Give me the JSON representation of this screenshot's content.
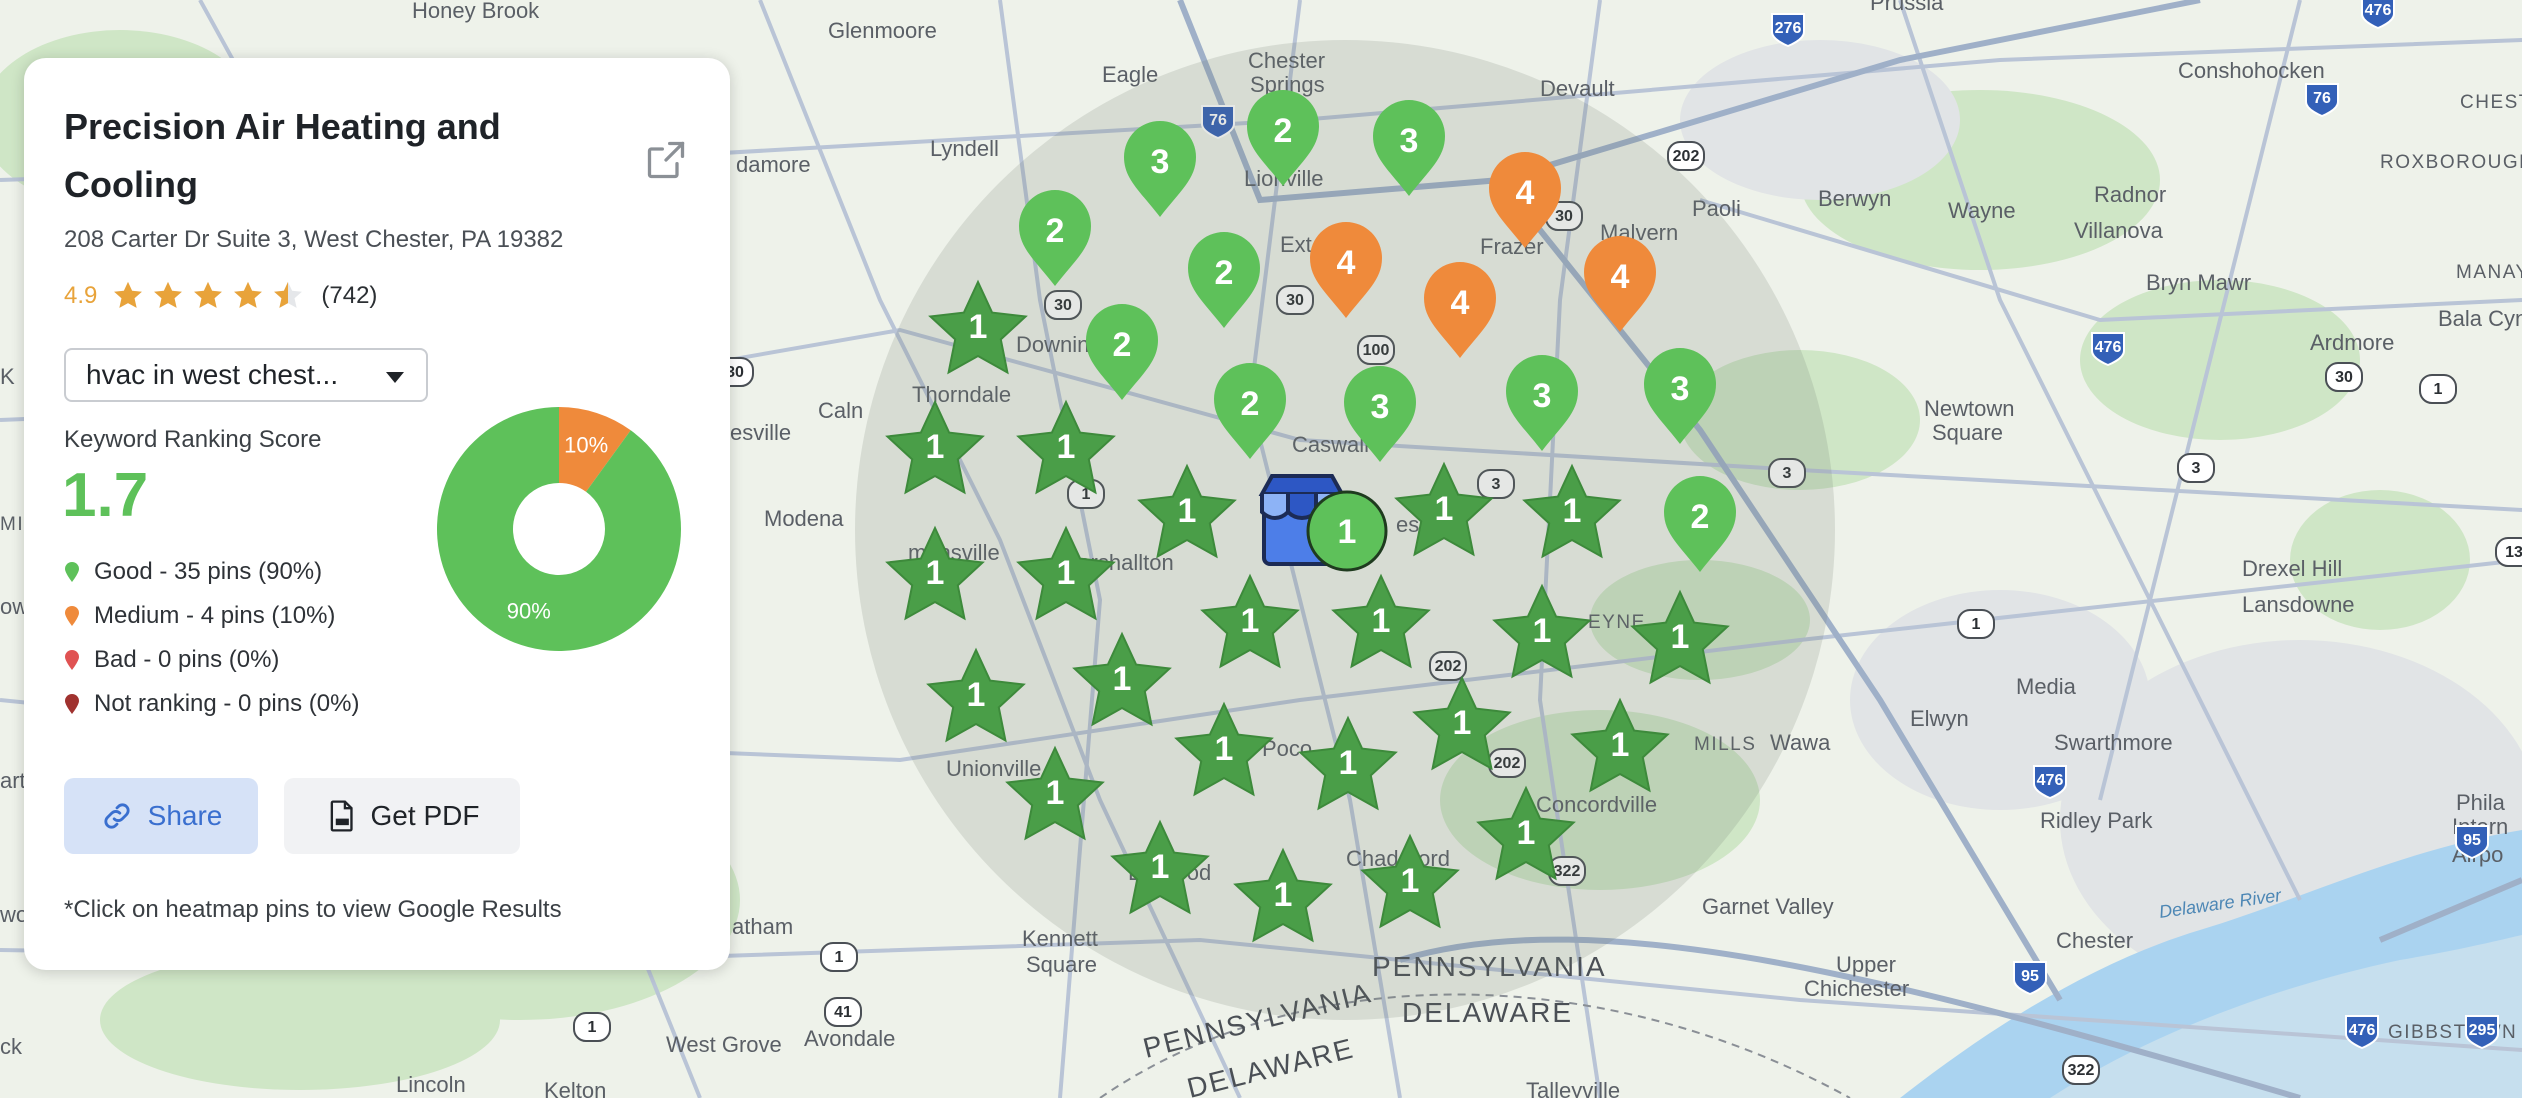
{
  "business": {
    "name": "Precision Air Heating and Cooling",
    "address": "208 Carter Dr Suite 3, West Chester, PA 19382",
    "rating": "4.9",
    "review_count": "(742)",
    "stars_filled": 4.5
  },
  "keyword": {
    "selected": "hvac in west chest..."
  },
  "score": {
    "label": "Keyword Ranking Score",
    "value": "1.7"
  },
  "legend": [
    {
      "label": "Good - 35 pins (90%)",
      "color": "#5ec15a"
    },
    {
      "label": "Medium - 4 pins (10%)",
      "color": "#ef8a3b"
    },
    {
      "label": "Bad - 0 pins (0%)",
      "color": "#e05252"
    },
    {
      "label": "Not ranking - 0 pins (0%)",
      "color": "#a0322f"
    }
  ],
  "donut": {
    "good_pct": 90,
    "medium_pct": 10,
    "good_label": "90%",
    "medium_label": "10%",
    "good_color": "#5ec15a",
    "medium_color": "#ef8a3b"
  },
  "actions": {
    "share": "Share",
    "pdf": "Get PDF"
  },
  "footnote": "*Click on heatmap pins to view Google Results",
  "center_pin": {
    "rank": "1"
  },
  "map_labels": {
    "honey_brook": "Honey Brook",
    "glenmoore": "Glenmoore",
    "chester_springs_1": "Chester",
    "chester_springs_2": "Springs",
    "eagle": "Eagle",
    "devault": "Devault",
    "prussia": "Prussia",
    "conshohocken": "Conshohocken",
    "chest": "CHEST",
    "roxborough": "ROXBOROUGH",
    "manayunk": "MANAYUN",
    "lyndell": "Lyndell",
    "lionville": "Lionville",
    "damore": "damore",
    "malvern": "Malvern",
    "frazer": "Frazer",
    "paoli": "Paoli",
    "berwyn": "Berwyn",
    "wayne": "Wayne",
    "radnor": "Radnor",
    "villanova": "Villanova",
    "bryn_mawr": "Bryn Mawr",
    "bala_cynwyd": "Bala Cynwy",
    "ardmore": "Ardmore",
    "exton": "Ext",
    "downingtown": "Downin",
    "thorndale": "Thorndale",
    "calm": "Caln",
    "coatesville": "esville",
    "caswallen": "Caswall",
    "newtown_square_1": "Newtown",
    "newtown_square_2": "Square",
    "modena": "Modena",
    "embreeville": "mansville",
    "marshallton": "Marshallton",
    "westchester": "es",
    "drexel_hill": "Drexel Hill",
    "lansdowne": "Lansdowne",
    "media": "Media",
    "elwyn": "Elwyn",
    "wawa": "Wawa",
    "swarthmore": "Swarthmore",
    "unionville": "Unionville",
    "pocopson": "Poco",
    "concordville": "Concordville",
    "ridley_park": "Ridley Park",
    "philadelphia_1": "Phila",
    "philadelphia_2": "Intern",
    "philadelphia_3": "Airpo",
    "chadds_ford": "Chad   Ford",
    "cheyney": "EYNE",
    "hills": "MILLS",
    "garnet_valley": "Garnet Valley",
    "kennett_1": "Kennett",
    "kennett_2": "Square",
    "longwood": "Lo   wood",
    "upper_chichester_1": "Upper",
    "upper_chichester_2": "Chichester",
    "chester": "Chester",
    "delaware_river": "Delaware River",
    "gibbstown": "GIBBSTOWN",
    "atham": "atham",
    "west_grove": "West Grove",
    "avondale": "Avondale",
    "lincoln": "Lincoln",
    "kelton": "Kelton",
    "tallevile": "Talleyville",
    "pa_1": "PENNSYLVANIA",
    "pa_2": "PENNSYLVANIA",
    "de_1": "DELAWARE",
    "de_2": "DELAWARE",
    "ck": "ck",
    "k": "K",
    "art": "art",
    "wo": "wo",
    "ow": "ow",
    "mi": "MI"
  },
  "map_shields": [
    "76",
    "276",
    "476",
    "76",
    "202",
    "30",
    "30",
    "30",
    "100",
    "3",
    "3",
    "3",
    "476",
    "476",
    "1",
    "13",
    "1",
    "476",
    "30",
    "202",
    "202",
    "322",
    "322",
    "95",
    "95",
    "295",
    "1",
    "41",
    "1",
    "1",
    "30"
  ]
}
